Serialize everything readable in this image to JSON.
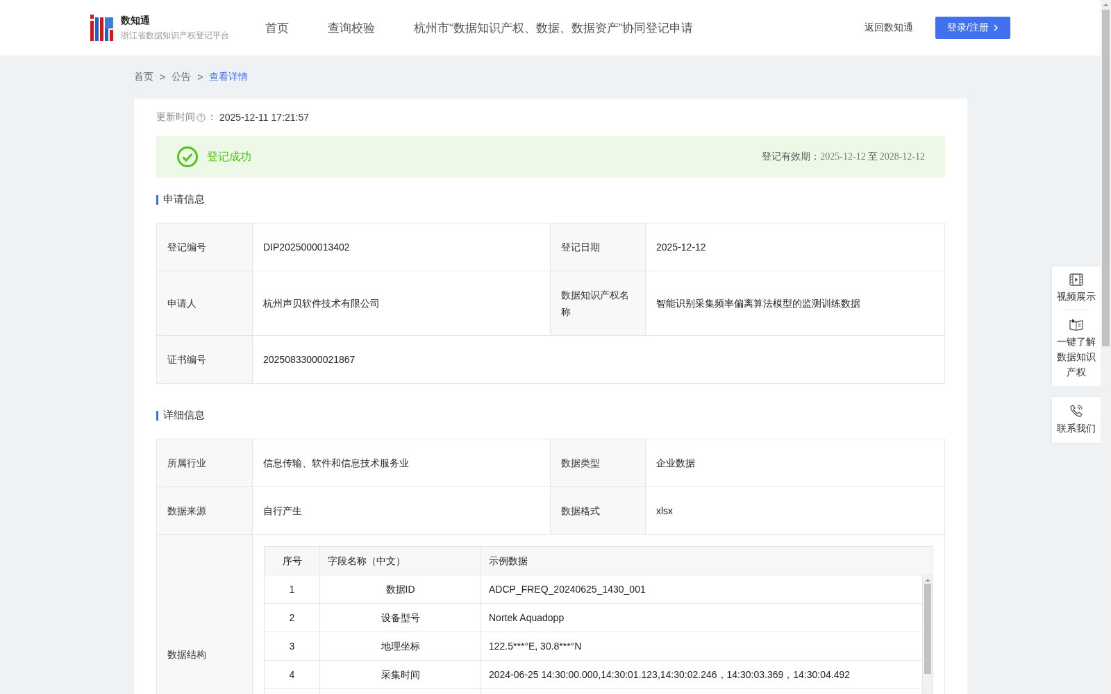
{
  "header": {
    "logo_title": "数知通",
    "logo_subtitle": "浙江省数据知识产权登记平台",
    "nav": [
      {
        "label": "首页",
        "selected": false
      },
      {
        "label": "查询校验",
        "selected": false
      },
      {
        "label": "杭州市“数据知识产权、数据、数据资产”协同登记申请",
        "selected": false
      }
    ],
    "back_link": "返回数知通",
    "login_button": "登录/注册"
  },
  "breadcrumb": [
    {
      "label": "首页",
      "selected": false
    },
    {
      "label": "公告",
      "selected": false
    },
    {
      "label": "查看详情",
      "selected": true
    }
  ],
  "breadcrumb_separator": ">",
  "update": {
    "label": "更新时间",
    "colon": "：",
    "value": "2025-12-11 17:21:57"
  },
  "status": {
    "text": "登记成功",
    "validity_label": "登记有效期：",
    "validity_from": "2025-12-12",
    "validity_to_word": "至",
    "validity_to": "2028-12-12"
  },
  "sections": [
    {
      "title": "申请信息",
      "rows": [
        {
          "cells": [
            {
              "label": "登记编号",
              "value": "DIP2025000013402"
            },
            {
              "label": "登记日期",
              "value": "2025-12-12"
            }
          ]
        },
        {
          "cells": [
            {
              "label": "申请人",
              "value": "杭州声贝软件技术有限公司"
            },
            {
              "label": "数据知识产权名称",
              "value": "智能识别采集频率偏离算法模型的监测训练数据"
            }
          ]
        },
        {
          "cells": [
            {
              "label": "证书编号",
              "value": "20250833000021867"
            }
          ]
        }
      ]
    },
    {
      "title": "详细信息",
      "rows": [
        {
          "cells": [
            {
              "label": "所属行业",
              "value": "信息传输、软件和信息技术服务业"
            },
            {
              "label": "数据类型",
              "value": "企业数据"
            }
          ]
        },
        {
          "cells": [
            {
              "label": "数据来源",
              "value": "自行产生"
            },
            {
              "label": "数据格式",
              "value": "xlsx"
            }
          ]
        }
      ]
    }
  ],
  "data_structure": {
    "label": "数据结构",
    "columns": [
      "序号",
      "字段名称（中文）",
      "示例数据"
    ],
    "rows": [
      {
        "index": "1",
        "field": "数据ID",
        "example": "ADCP_FREQ_20240625_1430_001"
      },
      {
        "index": "2",
        "field": "设备型号",
        "example": "Nortek Aquadopp"
      },
      {
        "index": "3",
        "field": "地理坐标",
        "example": "122.5***°E, 30.8***°N"
      },
      {
        "index": "4",
        "field": "采集时间",
        "example": "2024-06-25 14:30:00.000,14:30:01.123,14:30:02.246，14:30:03.369，14:30:04.492"
      }
    ]
  },
  "side_panel": [
    {
      "kind": "video",
      "label": "视频展示"
    },
    {
      "kind": "book",
      "label": "一键了解数据知识产权"
    },
    {
      "kind": "phone",
      "label": "联系我们"
    }
  ]
}
